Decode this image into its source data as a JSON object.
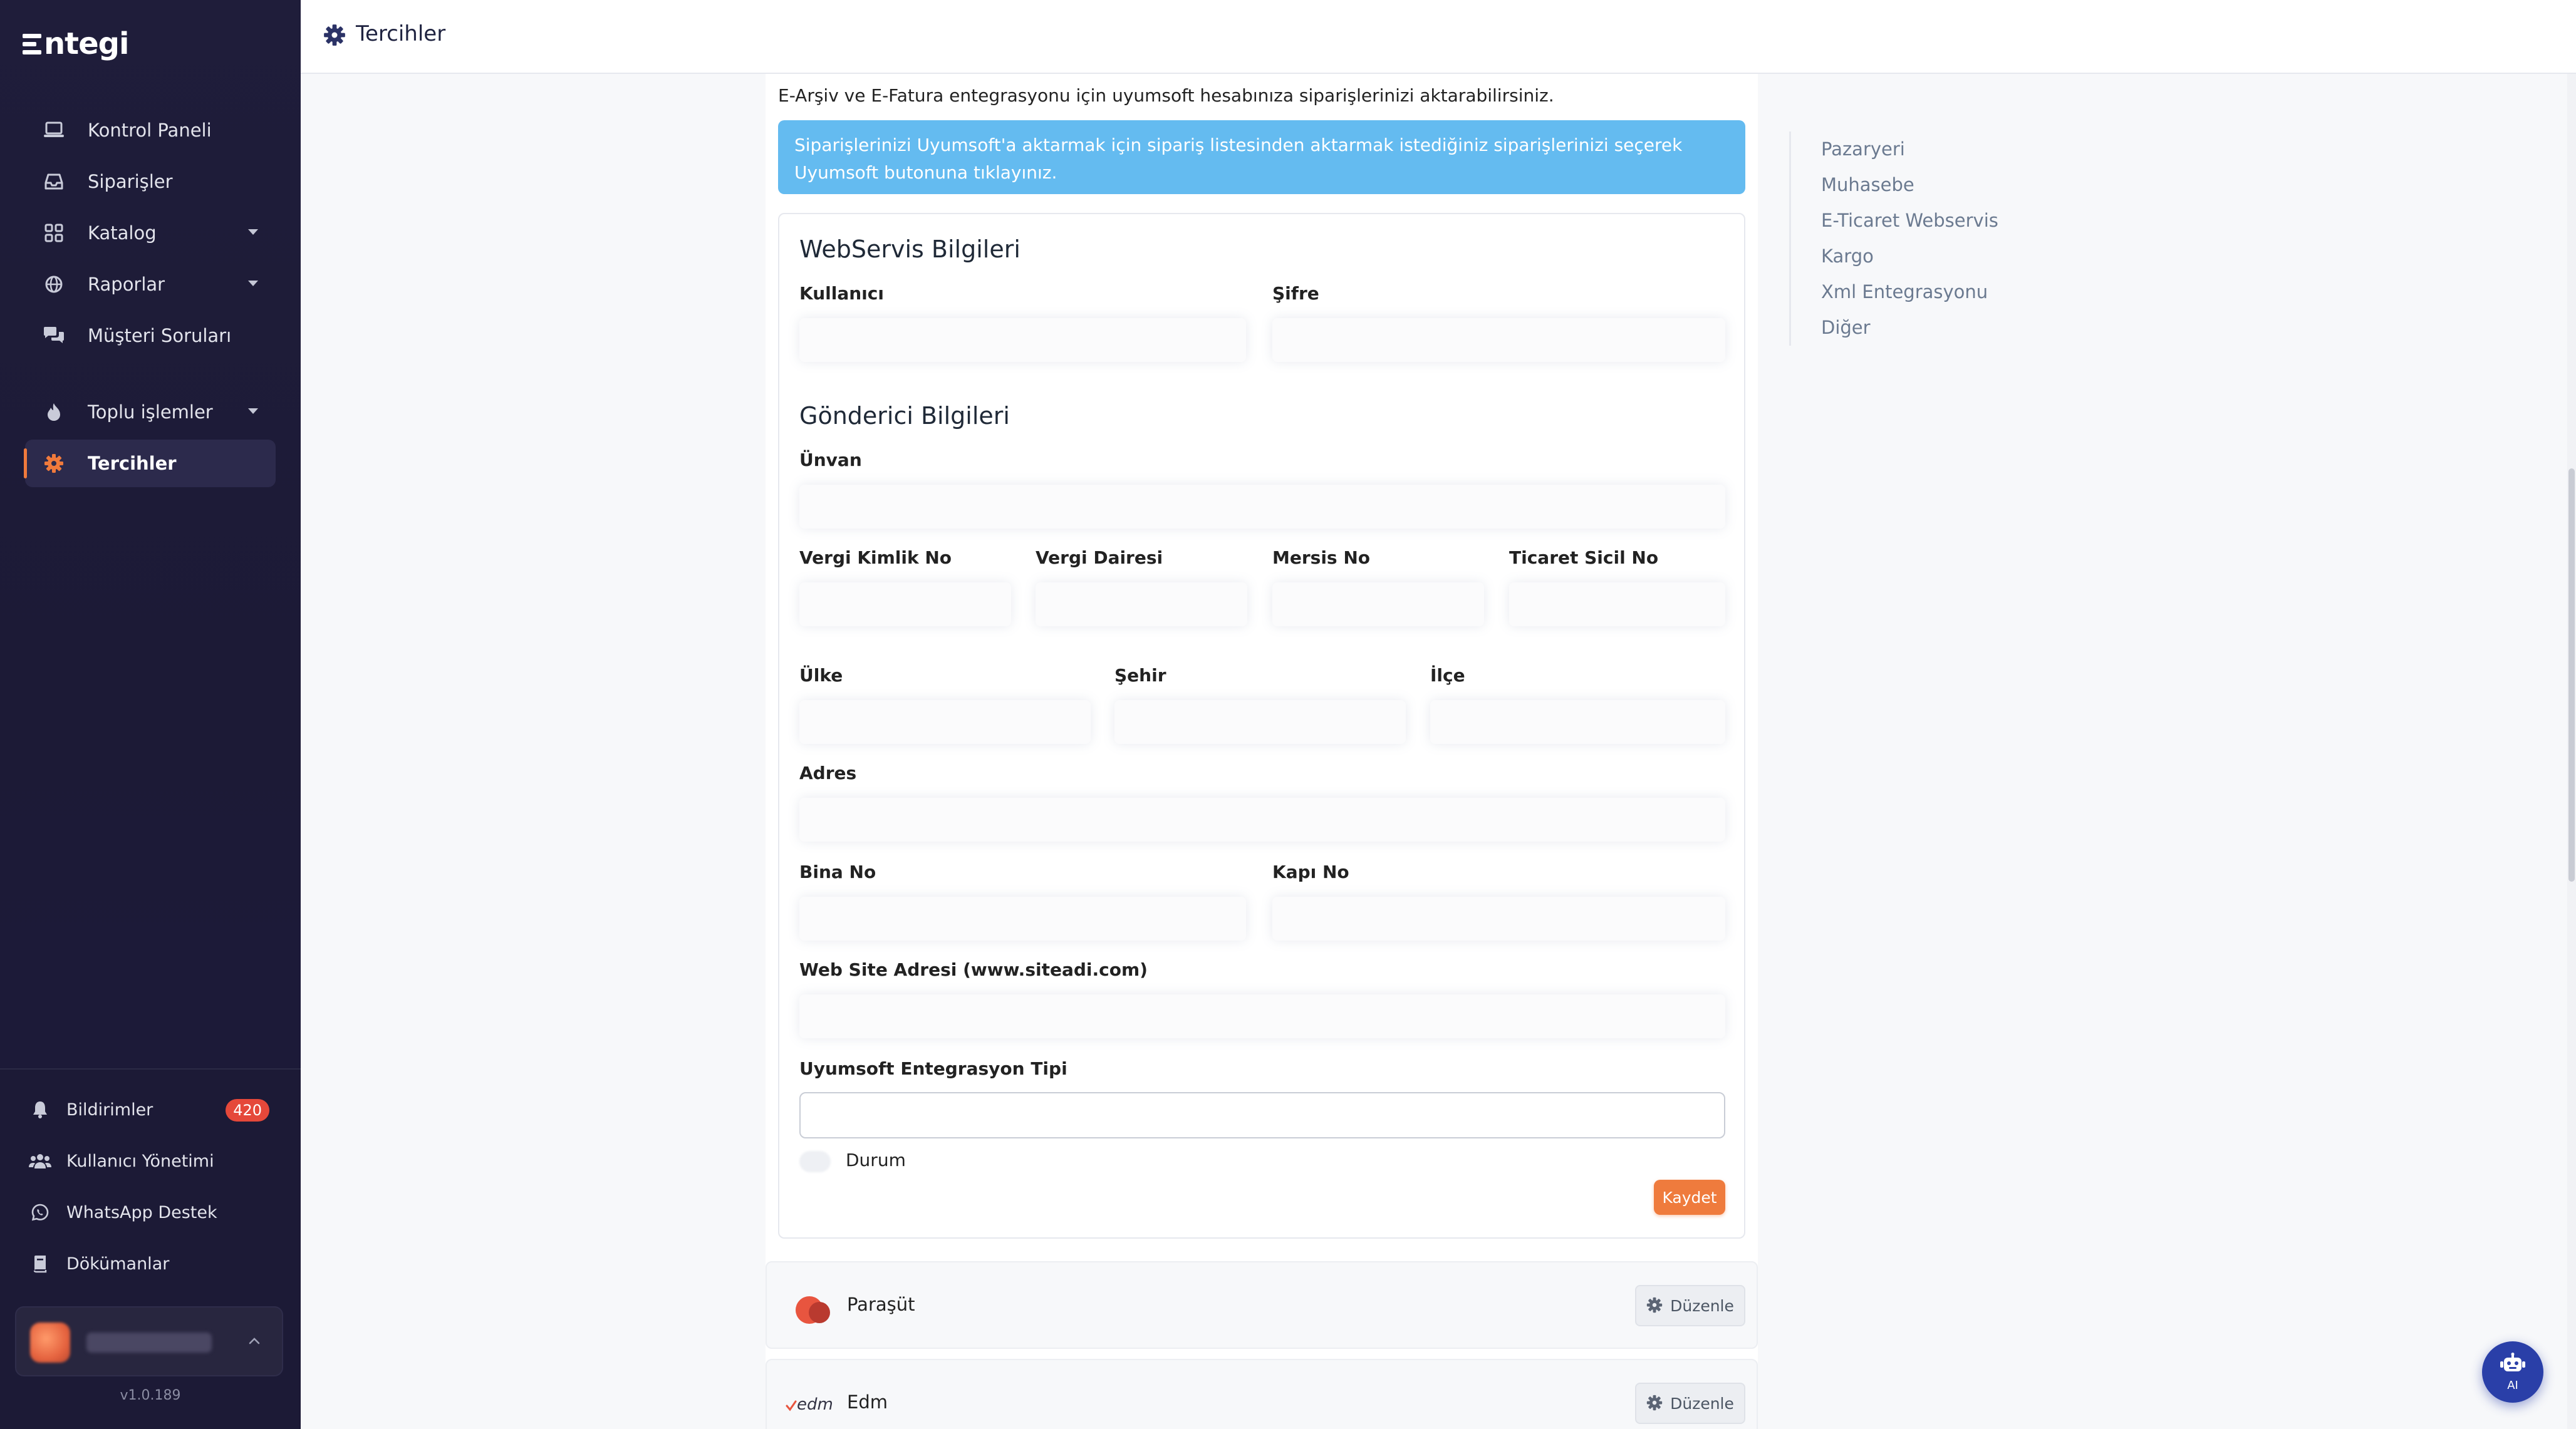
{
  "brand": {
    "name": "ntegi"
  },
  "sidebar": {
    "items": [
      {
        "label": "Kontrol Paneli"
      },
      {
        "label": "Siparişler"
      },
      {
        "label": "Katalog"
      },
      {
        "label": "Raporlar"
      },
      {
        "label": "Müşteri Soruları"
      },
      {
        "label": "Toplu işlemler"
      },
      {
        "label": "Tercihler"
      }
    ],
    "bottom": [
      {
        "label": "Bildirimler",
        "badge": "420"
      },
      {
        "label": "Kullanıcı Yönetimi"
      },
      {
        "label": "WhatsApp Destek"
      },
      {
        "label": "Dökümanlar"
      }
    ],
    "version": "v1.0.189"
  },
  "header": {
    "title": "Tercihler"
  },
  "main": {
    "intro": "E-Arşiv ve E-Fatura entegrasyonu için uyumsoft hesabınıza siparişlerinizi aktarabilirsiniz.",
    "info": "Siparişlerinizi Uyumsoft'a aktarmak için sipariş listesinden aktarmak istediğiniz siparişlerinizi seçerek Uyumsoft butonuna tıklayınız.",
    "webservis": {
      "title": "WebServis Bilgileri",
      "user_label": "Kullanıcı",
      "password_label": "Şifre"
    },
    "gonderici": {
      "title": "Gönderici Bilgileri",
      "unvan_label": "Ünvan",
      "vkn_label": "Vergi Kimlik No",
      "vergi_dairesi_label": "Vergi Dairesi",
      "mersis_label": "Mersis No",
      "ticaret_sicil_label": "Ticaret Sicil No",
      "ulke_label": "Ülke",
      "sehir_label": "Şehir",
      "ilce_label": "İlçe",
      "adres_label": "Adres",
      "bina_label": "Bina No",
      "kapi_label": "Kapı No",
      "web_label": "Web Site Adresi (www.siteadi.com)",
      "tip_label": "Uyumsoft Entegrasyon Tipi",
      "durum_label": "Durum",
      "save_label": "Kaydet"
    },
    "integrations": [
      {
        "name": "Paraşüt",
        "edit_label": "Düzenle"
      },
      {
        "name": "Edm",
        "edit_label": "Düzenle",
        "logo_text": "edm"
      }
    ]
  },
  "right_nav": [
    "Pazaryeri",
    "Muhasebe",
    "E-Ticaret Webservis",
    "Kargo",
    "Xml Entegrasyonu",
    "Diğer"
  ],
  "ai_button": {
    "label": "AI"
  }
}
